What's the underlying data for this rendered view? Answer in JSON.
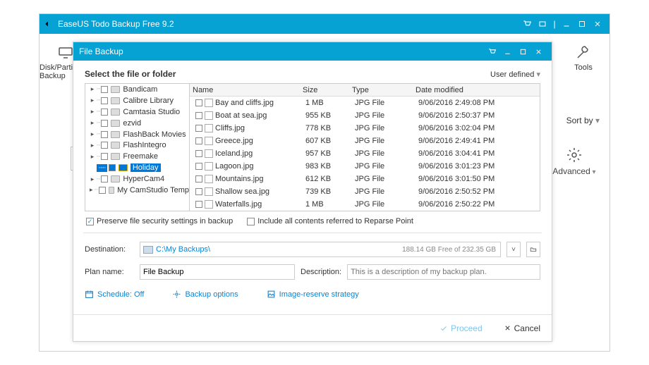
{
  "app": {
    "title": "EaseUS Todo Backup Free 9.2",
    "toolbar": {
      "disk_partition_label": "Disk/Partition Backup",
      "tools_label": "Tools"
    },
    "sort_by": "Sort by",
    "advanced": "Advanced"
  },
  "dialog": {
    "title": "File Backup",
    "heading": "Select the file or folder",
    "user_defined": "User defined",
    "tree": [
      {
        "label": "Bandicam",
        "exp": "▸",
        "sel": false
      },
      {
        "label": "Calibre Library",
        "exp": "▸",
        "sel": false
      },
      {
        "label": "Camtasia Studio",
        "exp": "▸",
        "sel": false
      },
      {
        "label": "ezvid",
        "exp": "▸",
        "sel": false
      },
      {
        "label": "FlashBack Movies",
        "exp": "▸",
        "sel": false
      },
      {
        "label": "FlashIntegro",
        "exp": "▸",
        "sel": false
      },
      {
        "label": "Freemake",
        "exp": "▸",
        "sel": false
      },
      {
        "label": "Holiday",
        "exp": "",
        "sel": true
      },
      {
        "label": "HyperCam4",
        "exp": "▸",
        "sel": false
      },
      {
        "label": "My CamStudio Temp",
        "exp": "▸",
        "sel": false
      }
    ],
    "columns": {
      "name": "Name",
      "size": "Size",
      "type": "Type",
      "date": "Date modified"
    },
    "files": [
      {
        "name": "Bay and cliffs.jpg",
        "size": "1 MB",
        "type": "JPG File",
        "date": "9/06/2016 2:49:08  PM"
      },
      {
        "name": "Boat at sea.jpg",
        "size": "955 KB",
        "type": "JPG File",
        "date": "9/06/2016 2:50:37  PM"
      },
      {
        "name": "Cliffs.jpg",
        "size": "778 KB",
        "type": "JPG File",
        "date": "9/06/2016 3:02:04  PM"
      },
      {
        "name": "Greece.jpg",
        "size": "607 KB",
        "type": "JPG File",
        "date": "9/06/2016 2:49:41  PM"
      },
      {
        "name": "Iceland.jpg",
        "size": "957 KB",
        "type": "JPG File",
        "date": "9/06/2016 3:04:41  PM"
      },
      {
        "name": "Lagoon.jpg",
        "size": "983 KB",
        "type": "JPG File",
        "date": "9/06/2016 3:01:23  PM"
      },
      {
        "name": "Mountains.jpg",
        "size": "612 KB",
        "type": "JPG File",
        "date": "9/06/2016 3:01:50  PM"
      },
      {
        "name": "Shallow sea.jpg",
        "size": "739 KB",
        "type": "JPG File",
        "date": "9/06/2016 2:50:52  PM"
      },
      {
        "name": "Waterfalls.jpg",
        "size": "1 MB",
        "type": "JPG File",
        "date": "9/06/2016 2:50:22  PM"
      }
    ],
    "opt_preserve": "Preserve file security settings in backup",
    "opt_reparse": "Include all contents referred to Reparse Point",
    "destination_label": "Destination:",
    "destination_path": "C:\\My Backups\\",
    "destination_free": "188.14 GB Free of 232.35 GB",
    "plan_label": "Plan name:",
    "plan_value": "File Backup",
    "desc_label": "Description:",
    "desc_placeholder": "This is a description of my backup plan.",
    "link_schedule": "Schedule: Off",
    "link_options": "Backup options",
    "link_image": "Image-reserve strategy",
    "btn_proceed": "Proceed",
    "btn_cancel": "Cancel"
  }
}
